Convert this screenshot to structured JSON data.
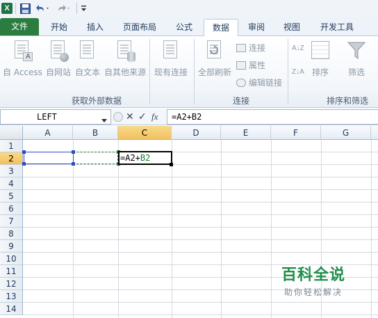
{
  "quick_access": {
    "logo": "X",
    "icons": [
      "excel-icon",
      "save-icon",
      "undo-icon",
      "redo-icon",
      "customize-icon"
    ]
  },
  "tabs": [
    {
      "label": "文件"
    },
    {
      "label": "开始"
    },
    {
      "label": "插入"
    },
    {
      "label": "页面布局"
    },
    {
      "label": "公式"
    },
    {
      "label": "数据"
    },
    {
      "label": "审阅"
    },
    {
      "label": "视图"
    },
    {
      "label": "开发工具"
    }
  ],
  "ribbon": {
    "external": {
      "access": "自 Access",
      "web": "自网站",
      "text": "自文本",
      "other": "自其他来源",
      "existing": "现有连接",
      "group": "获取外部数据",
      "access_badge": "A"
    },
    "connections": {
      "refresh": "全部刷新",
      "connect": "连接",
      "properties": "属性",
      "edit_links": "编辑链接",
      "group": "连接"
    },
    "sort": {
      "sort_az": "A↓Z",
      "sort_za": "Z↓A",
      "sort": "排序",
      "filter": "筛选",
      "group": "排序和筛选"
    }
  },
  "formula_bar": {
    "name_box": "LEFT",
    "cancel_symbol": "✕",
    "enter_symbol": "✓",
    "fx_symbol": "fx",
    "formula": "=A2+B2"
  },
  "grid": {
    "columns": [
      "A",
      "B",
      "C",
      "D",
      "E",
      "F",
      "G"
    ],
    "rows": [
      "1",
      "2",
      "3",
      "4",
      "5",
      "6",
      "7",
      "8",
      "9",
      "10",
      "11",
      "12",
      "13",
      "14"
    ],
    "editing_cell": {
      "prefix": "=A2+",
      "ref": "B2"
    }
  },
  "watermark": {
    "title": "百科全说",
    "subtitle": "助你轻松解决"
  },
  "colors": {
    "file_tab": "#2a7d3f",
    "selected_header": "#f1c15f",
    "ref_a2": "#2b49c9",
    "ref_b2": "#1e7a2d"
  }
}
